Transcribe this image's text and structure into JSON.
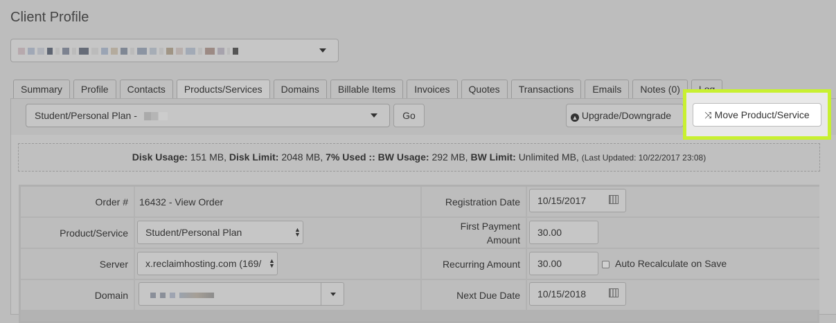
{
  "page": {
    "title": "Client Profile"
  },
  "tabs": [
    {
      "label": "Summary"
    },
    {
      "label": "Profile"
    },
    {
      "label": "Contacts"
    },
    {
      "label": "Products/Services"
    },
    {
      "label": "Domains"
    },
    {
      "label": "Billable Items"
    },
    {
      "label": "Invoices"
    },
    {
      "label": "Quotes"
    },
    {
      "label": "Transactions"
    },
    {
      "label": "Emails"
    },
    {
      "label": "Notes (0)"
    },
    {
      "label": "Log"
    }
  ],
  "toolbar": {
    "product_select": "Student/Personal Plan -",
    "go_label": "Go",
    "upgrade_label": "Upgrade/Downgrade",
    "move_label": "Move Product/Service"
  },
  "usage": {
    "disk_usage_label": "Disk Usage:",
    "disk_usage_value": "151 MB,",
    "disk_limit_label": "Disk Limit:",
    "disk_limit_value": "2048 MB,",
    "used_label": "7% Used ::",
    "bw_usage_label": "BW Usage:",
    "bw_usage_value": "292 MB,",
    "bw_limit_label": "BW Limit:",
    "bw_limit_value": "Unlimited MB,",
    "last_updated": "(Last Updated: 10/22/2017 23:08)"
  },
  "details": {
    "order_label": "Order #",
    "order_value": "16432 - View Order",
    "product_label": "Product/Service",
    "product_value": "Student/Personal Plan",
    "server_label": "Server",
    "server_value": "x.reclaimhosting.com (169/",
    "domain_label": "Domain",
    "reg_date_label": "Registration Date",
    "reg_date_value": "10/15/2017",
    "first_payment_label_1": "First Payment",
    "first_payment_label_2": "Amount",
    "first_payment_value": "30.00",
    "recurring_label": "Recurring Amount",
    "recurring_value": "30.00",
    "auto_recalc_label": "Auto Recalculate on Save",
    "next_due_label": "Next Due Date",
    "next_due_value": "10/15/2018"
  },
  "colors": {
    "highlight": "#c8f031"
  }
}
